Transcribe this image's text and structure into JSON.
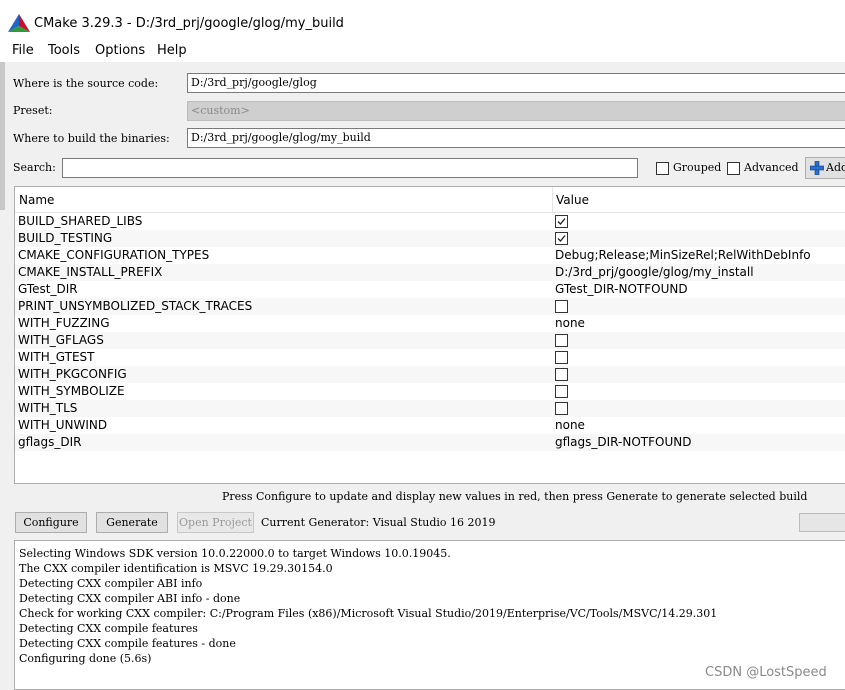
{
  "window": {
    "title": "CMake 3.29.3 - D:/3rd_prj/google/glog/my_build",
    "logo_icon": "cmake-triangle-icon"
  },
  "menu": [
    "File",
    "Tools",
    "Options",
    "Help"
  ],
  "source": {
    "label": "Where is the source code:",
    "value": "D:/3rd_prj/google/glog"
  },
  "preset": {
    "label": "Preset:",
    "value": "<custom>"
  },
  "build": {
    "label": "Where to build the binaries:",
    "value": "D:/3rd_prj/google/glog/my_build"
  },
  "search": {
    "label": "Search:",
    "value": ""
  },
  "options": {
    "grouped_label": "Grouped",
    "grouped_checked": false,
    "advanced_label": "Advanced",
    "advanced_checked": false,
    "add_entry_label": "Add",
    "add_icon": "plus-icon"
  },
  "table": {
    "headers": [
      "Name",
      "Value"
    ],
    "rows": [
      {
        "name": "BUILD_SHARED_LIBS",
        "type": "bool",
        "checked": true
      },
      {
        "name": "BUILD_TESTING",
        "type": "bool",
        "checked": true
      },
      {
        "name": "CMAKE_CONFIGURATION_TYPES",
        "type": "text",
        "value": "Debug;Release;MinSizeRel;RelWithDebInfo"
      },
      {
        "name": "CMAKE_INSTALL_PREFIX",
        "type": "text",
        "value": "D:/3rd_prj/google/glog/my_install"
      },
      {
        "name": "GTest_DIR",
        "type": "text",
        "value": "GTest_DIR-NOTFOUND"
      },
      {
        "name": "PRINT_UNSYMBOLIZED_STACK_TRACES",
        "type": "bool",
        "checked": false
      },
      {
        "name": "WITH_FUZZING",
        "type": "text",
        "value": "none"
      },
      {
        "name": "WITH_GFLAGS",
        "type": "bool",
        "checked": false
      },
      {
        "name": "WITH_GTEST",
        "type": "bool",
        "checked": false
      },
      {
        "name": "WITH_PKGCONFIG",
        "type": "bool",
        "checked": false
      },
      {
        "name": "WITH_SYMBOLIZE",
        "type": "bool",
        "checked": false
      },
      {
        "name": "WITH_TLS",
        "type": "bool",
        "checked": false
      },
      {
        "name": "WITH_UNWIND",
        "type": "text",
        "value": "none"
      },
      {
        "name": "gflags_DIR",
        "type": "text",
        "value": "gflags_DIR-NOTFOUND"
      }
    ]
  },
  "hint": "Press Configure to update and display new values in red, then press Generate to generate selected build",
  "buttons": {
    "configure": "Configure",
    "generate": "Generate",
    "open_project": "Open Project"
  },
  "generator": "Current Generator: Visual Studio 16 2019",
  "output": [
    "Selecting Windows SDK version 10.0.22000.0 to target Windows 10.0.19045.",
    "The CXX compiler identification is MSVC 19.29.30154.0",
    "Detecting CXX compiler ABI info",
    "Detecting CXX compiler ABI info - done",
    "Check for working CXX compiler: C:/Program Files (x86)/Microsoft Visual Studio/2019/Enterprise/VC/Tools/MSVC/14.29.301",
    "Detecting CXX compile features",
    "Detecting CXX compile features - done",
    "Configuring done (5.6s)"
  ],
  "watermark": "CSDN @LostSpeed"
}
